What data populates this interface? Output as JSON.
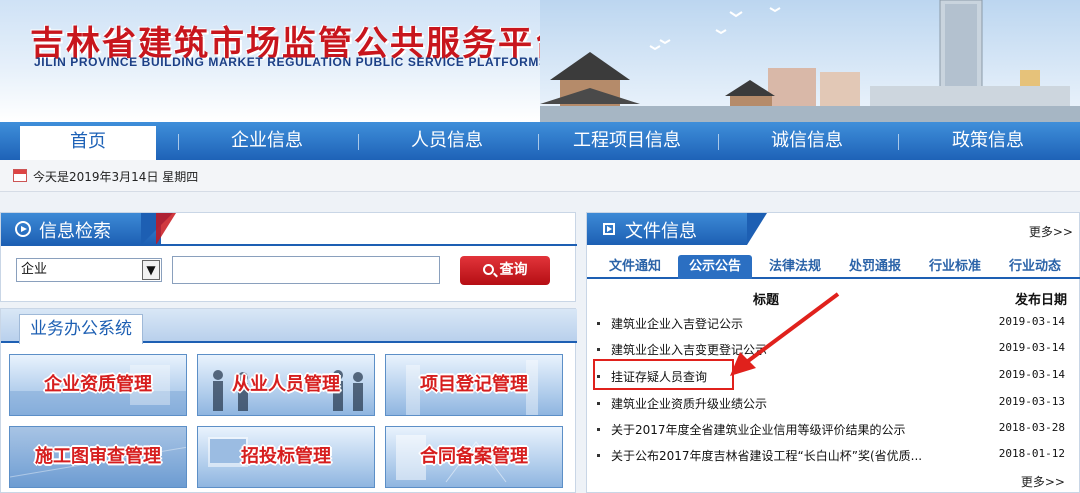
{
  "header": {
    "title": "吉林省建筑市场监管公共服务平台",
    "subtitle": "JILIN PROVINCE BUILDING MARKET REGULATION PUBLIC SERVICE PLATFORMS"
  },
  "nav": {
    "items": [
      {
        "label": "首页"
      },
      {
        "label": "企业信息"
      },
      {
        "label": "人员信息"
      },
      {
        "label": "工程项目信息"
      },
      {
        "label": "诚信信息"
      },
      {
        "label": "政策信息"
      }
    ]
  },
  "date_bar": {
    "text": "今天是2019年3月14日  星期四"
  },
  "search": {
    "title": "信息检索",
    "select_value": "企业",
    "input_value": "",
    "button_label": "查询"
  },
  "business": {
    "title": "业务办公系统",
    "tiles": [
      {
        "label": "企业资质管理"
      },
      {
        "label": "从业人员管理"
      },
      {
        "label": "项目登记管理"
      },
      {
        "label": "施工图审查管理"
      },
      {
        "label": "招投标管理"
      },
      {
        "label": "合同备案管理"
      }
    ]
  },
  "files": {
    "title": "文件信息",
    "more_label": "更多>>",
    "tabs": [
      {
        "label": "文件通知"
      },
      {
        "label": "公示公告"
      },
      {
        "label": "法律法规"
      },
      {
        "label": "处罚通报"
      },
      {
        "label": "行业标准"
      },
      {
        "label": "行业动态"
      }
    ],
    "active_tab": "公示公告",
    "col_title": "标题",
    "col_date": "发布日期",
    "rows": [
      {
        "title": "建筑业企业入吉登记公示",
        "date": "2019-03-14"
      },
      {
        "title": "建筑业企业入吉变更登记公示",
        "date": "2019-03-14"
      },
      {
        "title": "挂证存疑人员查询",
        "date": "2019-03-14"
      },
      {
        "title": "建筑业企业资质升级业绩公示",
        "date": "2019-03-13"
      },
      {
        "title": "关于2017年度全省建筑业企业信用等级评价结果的公示",
        "date": "2018-03-28"
      },
      {
        "title": "关于公布2017年度吉林省建设工程“长白山杯”奖(省优质...",
        "date": "2018-01-12"
      }
    ],
    "bottom_more_label": "更多>>"
  },
  "colors": {
    "brand_blue": "#1e62b7",
    "brand_red": "#c8161d",
    "highlight_red": "#e0211c"
  }
}
